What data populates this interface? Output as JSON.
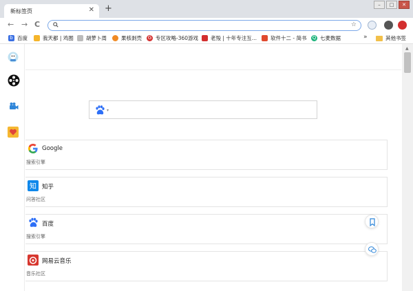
{
  "tab": {
    "title": "新标签页",
    "close": "✕"
  },
  "new_tab": "+",
  "window": {
    "minimize": "–",
    "maximize": "□",
    "close": "✕"
  },
  "nav": {
    "back": "←",
    "forward": "→",
    "reload": "C"
  },
  "omnibox": {
    "value": "",
    "placeholder": ""
  },
  "bookmarks": [
    {
      "label": "百度",
      "color": "#3a6fe3",
      "glyph": "🐾"
    },
    {
      "label": "我天都 | 鸡图",
      "color": "#f5b52b",
      "glyph": "●"
    },
    {
      "label": "胡萝卜周",
      "color": "#8a8a8a",
      "glyph": "✿"
    },
    {
      "label": "果核剥壳",
      "color": "#f08a24",
      "glyph": "◉"
    },
    {
      "label": "专区攻略-360游戏",
      "color": "#d32f2f",
      "glyph": "G"
    },
    {
      "label": "老殁 | 十年专注互...",
      "color": "#d32f2f",
      "glyph": "殁"
    },
    {
      "label": "软件十二 - 简书",
      "color": "#e04a2f",
      "glyph": "简"
    },
    {
      "label": "七麦数据",
      "color": "#1bb37a",
      "glyph": "Q"
    }
  ],
  "bookmarks_more": "»",
  "bookmarks_other": "其他书签",
  "search": {
    "value": "",
    "engine_caret": "▾"
  },
  "sites": [
    {
      "title": "Google",
      "subtitle": "搜索引擎",
      "logo": "google"
    },
    {
      "title": "知乎",
      "subtitle": "问答社区",
      "logo": "zhihu"
    },
    {
      "title": "百度",
      "subtitle": "搜索引擎",
      "logo": "baidu"
    },
    {
      "title": "网易云音乐",
      "subtitle": "音乐社区",
      "logo": "netease"
    }
  ],
  "colors": {
    "google_blue": "#4285f4",
    "zhihu_blue": "#0f88eb",
    "baidu_blue": "#2d6ff7",
    "netease_red": "#d7372f",
    "tabstrip": "#dee1e6"
  }
}
